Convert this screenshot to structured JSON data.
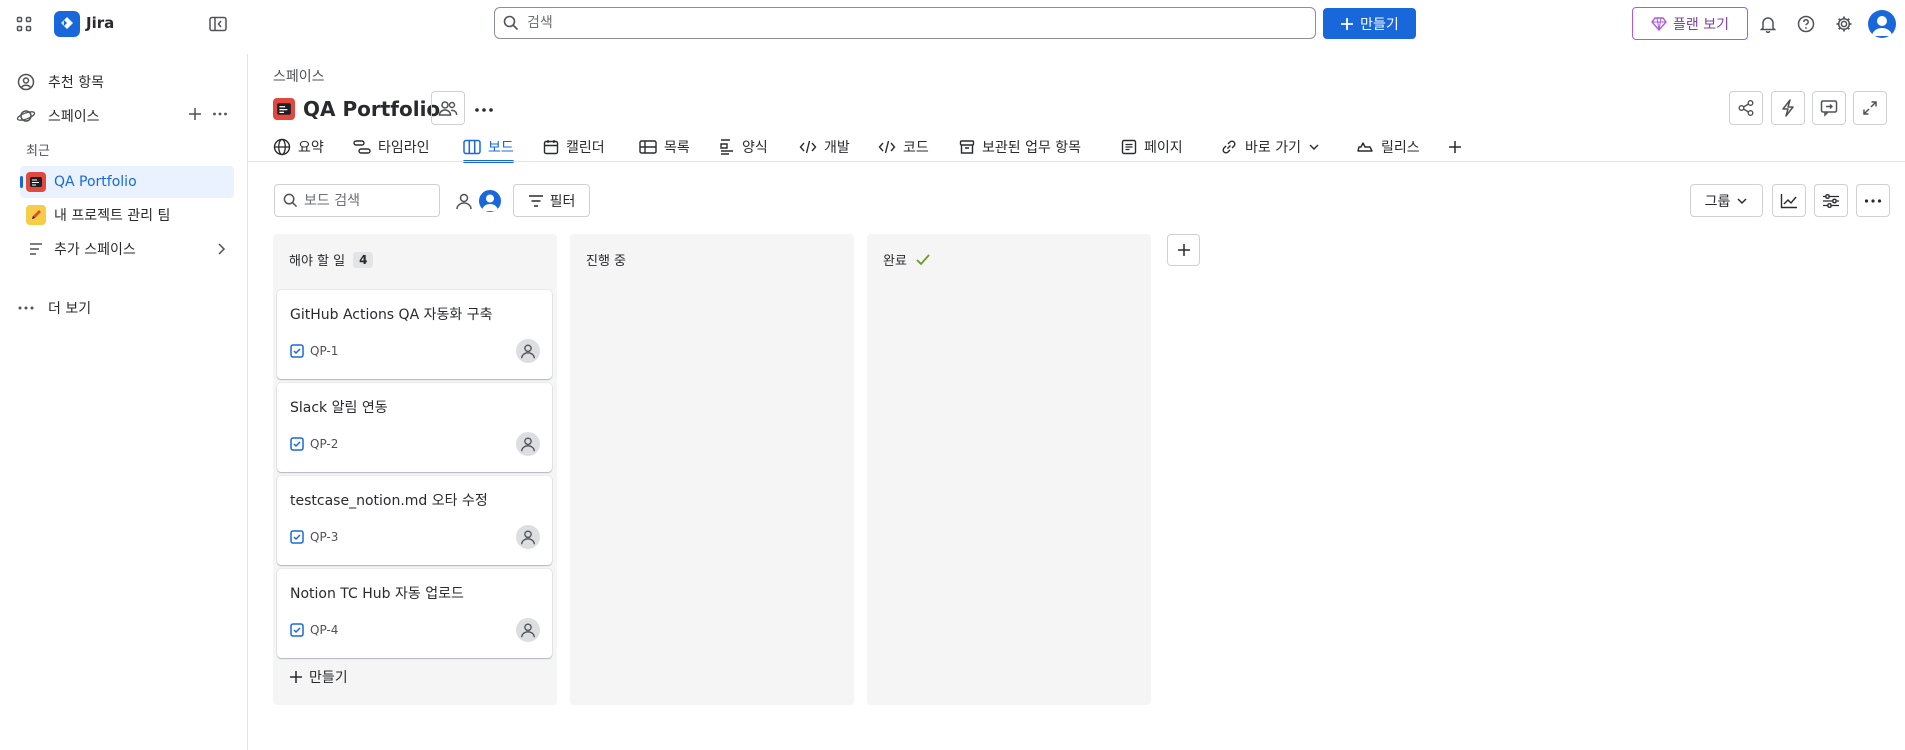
{
  "app": {
    "name": "Jira"
  },
  "top": {
    "search_placeholder": "검색",
    "create_label": "만들기",
    "plan_label": "플랜 보기"
  },
  "sidebar": {
    "recommended": "추천 항목",
    "spaces": "스페이스",
    "recent_heading": "최근",
    "projects": [
      {
        "name": "QA Portfolio",
        "selected": true
      },
      {
        "name": "내 프로젝트 관리 팀",
        "selected": false
      }
    ],
    "more_spaces": "추가 스페이스",
    "more": "더 보기"
  },
  "header": {
    "breadcrumb": "스페이스",
    "title": "QA Portfolio"
  },
  "tabs": [
    {
      "label": "요약",
      "icon": "globe-icon"
    },
    {
      "label": "타임라인",
      "icon": "timeline-icon"
    },
    {
      "label": "보드",
      "icon": "board-icon",
      "active": true
    },
    {
      "label": "캘린더",
      "icon": "calendar-icon"
    },
    {
      "label": "목록",
      "icon": "list-icon"
    },
    {
      "label": "양식",
      "icon": "form-icon"
    },
    {
      "label": "개발",
      "icon": "code-icon"
    },
    {
      "label": "코드",
      "icon": "code-icon"
    },
    {
      "label": "보관된 업무 항목",
      "icon": "archive-icon"
    },
    {
      "label": "페이지",
      "icon": "page-icon"
    },
    {
      "label": "바로 가기",
      "icon": "link-icon"
    },
    {
      "label": "릴리스",
      "icon": "release-icon"
    }
  ],
  "toolbar": {
    "board_search_placeholder": "보드 검색",
    "filter_label": "필터",
    "group_label": "그룹"
  },
  "columns": [
    {
      "title": "해야 할 일",
      "count": "4",
      "cards": [
        {
          "title": "GitHub Actions QA 자동화 구축",
          "key": "QP-1"
        },
        {
          "title": "Slack 알림 연동",
          "key": "QP-2"
        },
        {
          "title": "testcase_notion.md 오타 수정",
          "key": "QP-3"
        },
        {
          "title": "Notion TC Hub 자동 업로드",
          "key": "QP-4"
        }
      ],
      "create_label": "만들기"
    },
    {
      "title": "진행 중",
      "cards": []
    },
    {
      "title": "완료",
      "cards": [],
      "done": true
    }
  ],
  "colors": {
    "brand": "#1868DB",
    "plan_border": "#AF59E1",
    "done_check": "#6A9A23"
  }
}
